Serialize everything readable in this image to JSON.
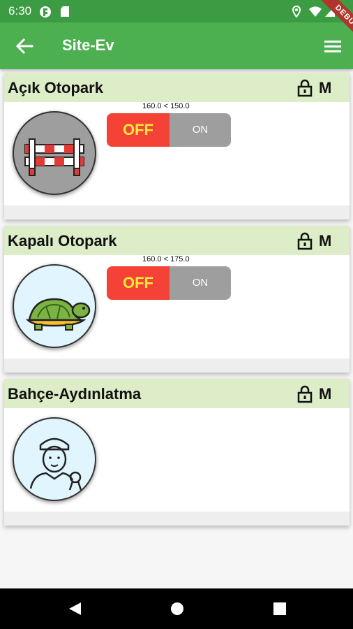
{
  "status_bar": {
    "time": "6:30",
    "icons": [
      "flutter-icon",
      "sd-card-icon",
      "location-icon",
      "wifi-icon",
      "signal-icon",
      "battery-icon"
    ]
  },
  "app_bar": {
    "title": "Site-Ev",
    "back_icon": "arrow-left-icon",
    "menu_icon": "hamburger-menu-icon",
    "debug_banner": "DEBUG"
  },
  "cards": [
    {
      "title": "Açık Otopark",
      "mode": "M",
      "icon": "barrier-icon",
      "threshold": "160.0 < 150.0",
      "toggle": {
        "off_label": "OFF",
        "on_label": "ON",
        "state": "off"
      }
    },
    {
      "title": "Kapalı Otopark",
      "mode": "M",
      "icon": "turtle-icon",
      "threshold": "160.0 < 175.0",
      "toggle": {
        "off_label": "OFF",
        "on_label": "ON",
        "state": "off"
      }
    },
    {
      "title": "Bahçe-Aydınlatma",
      "mode": "M",
      "icon": "person-icon"
    }
  ],
  "colors": {
    "app_bar": "#4caf50",
    "status_bar": "#3c9c43",
    "card_header": "#dcedc8",
    "toggle_off": "#f44336",
    "toggle_off_text": "#ffeb3b",
    "toggle_on": "#9e9e9e"
  },
  "nav_bar": {
    "icons": [
      "back-triangle-icon",
      "home-circle-icon",
      "recents-square-icon"
    ]
  }
}
